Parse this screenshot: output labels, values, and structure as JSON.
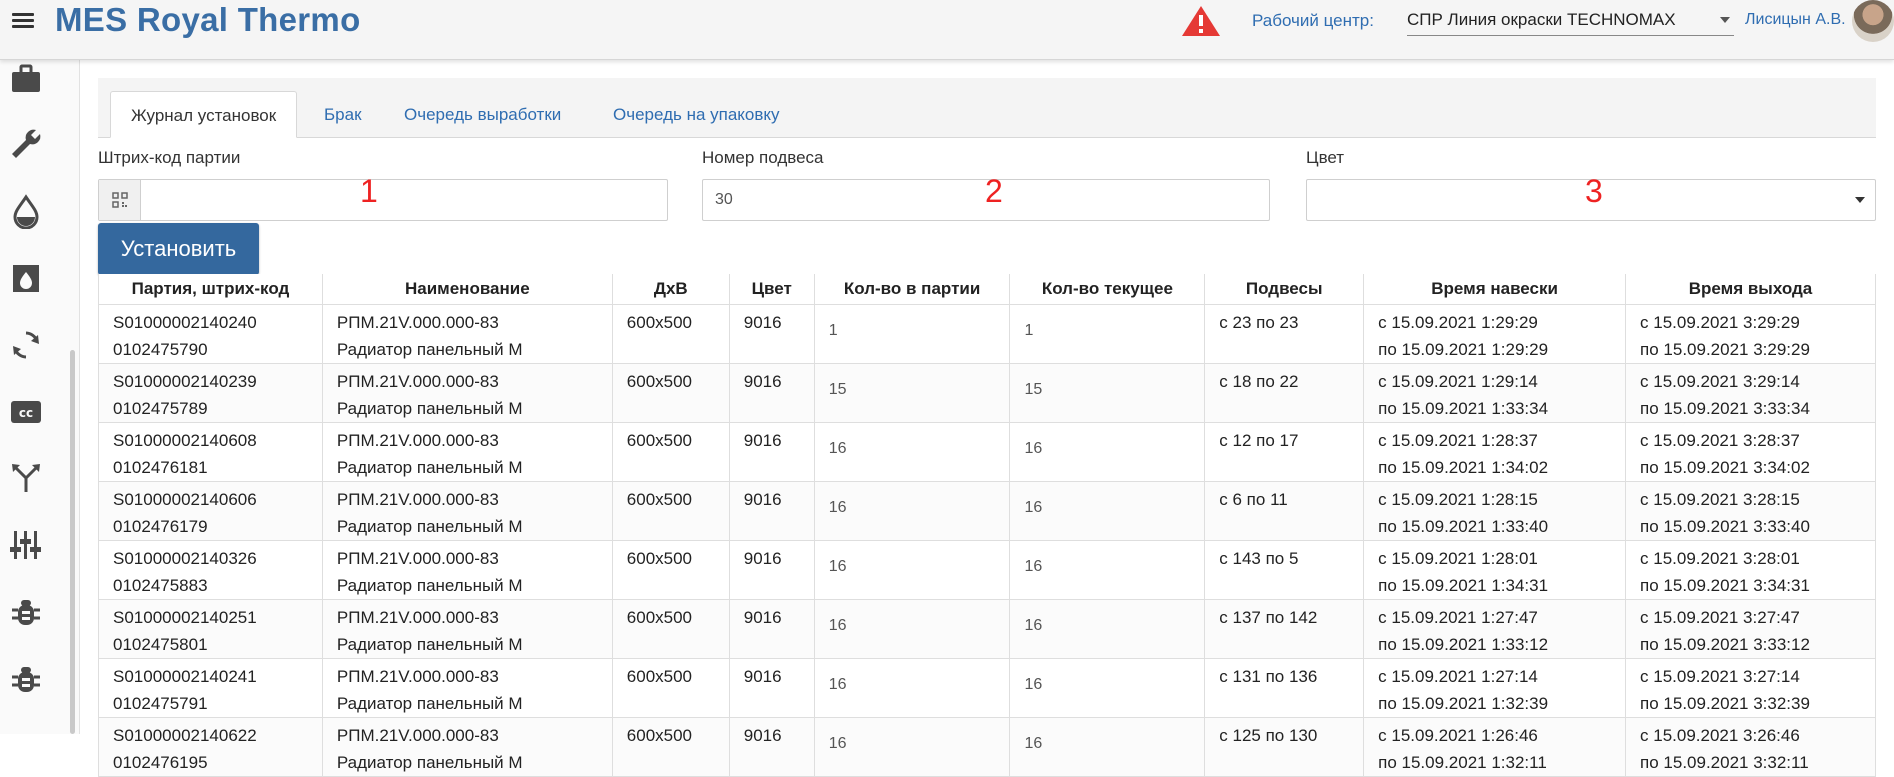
{
  "header": {
    "app_title": "MES Royal Thermo",
    "workcenter_label": "Рабочий центр:",
    "workcenter_value": "СПР Линия окраски TECHNOMAX",
    "user_name": "Лисицын А.В.",
    "colors": {
      "title": "#3a6ea5",
      "warning": "#e53935",
      "link": "#2f6db1"
    }
  },
  "sidebar": {
    "icons": [
      "briefcase-icon",
      "wrench-icon",
      "drop-icon",
      "furnace-icon",
      "refresh-icon",
      "cc-icon",
      "merge-icon",
      "equalizer-icon",
      "bug-icon",
      "bug-icon"
    ]
  },
  "tabs": [
    {
      "label": "Журнал установок",
      "active": true
    },
    {
      "label": "Брак",
      "active": false
    },
    {
      "label": "Очередь выработки",
      "active": false
    },
    {
      "label": "Очередь на упаковку",
      "active": false
    }
  ],
  "form": {
    "barcode_label": "Штрих-код партии",
    "barcode_value": "",
    "hanger_label": "Номер подвеса",
    "hanger_value": "30",
    "color_label": "Цвет",
    "color_value": "",
    "marker_1": "1",
    "marker_2": "2",
    "marker_3": "3",
    "install_button": "Установить"
  },
  "table": {
    "headers": [
      "Партия, штрих-код",
      "Наименование",
      "ДхВ",
      "Цвет",
      "Кол-во в партии",
      "Кол-во текущее",
      "Подвесы",
      "Время навески",
      "Время выхода"
    ],
    "rows": [
      {
        "batch": "S01000002140240",
        "barcode": "0102475790",
        "name1": "РПМ.21V.000.000-83",
        "name2": "Радиатор панельный М",
        "size": "600x500",
        "color": "9016",
        "qty_batch": "1",
        "qty_current": "1",
        "hangers": "с 23 по 23",
        "hang_from": "с 15.09.2021 1:29:29",
        "hang_to": "по 15.09.2021 1:29:29",
        "exit_from": "с 15.09.2021 3:29:29",
        "exit_to": "по 15.09.2021 3:29:29"
      },
      {
        "batch": "S01000002140239",
        "barcode": "0102475789",
        "name1": "РПМ.21V.000.000-83",
        "name2": "Радиатор панельный М",
        "size": "600x500",
        "color": "9016",
        "qty_batch": "15",
        "qty_current": "15",
        "hangers": "с 18 по 22",
        "hang_from": "с 15.09.2021 1:29:14",
        "hang_to": "по 15.09.2021 1:33:34",
        "exit_from": "с 15.09.2021 3:29:14",
        "exit_to": "по 15.09.2021 3:33:34"
      },
      {
        "batch": "S01000002140608",
        "barcode": "0102476181",
        "name1": "РПМ.21V.000.000-83",
        "name2": "Радиатор панельный М",
        "size": "600x500",
        "color": "9016",
        "qty_batch": "16",
        "qty_current": "16",
        "hangers": "с 12 по 17",
        "hang_from": "с 15.09.2021 1:28:37",
        "hang_to": "по 15.09.2021 1:34:02",
        "exit_from": "с 15.09.2021 3:28:37",
        "exit_to": "по 15.09.2021 3:34:02"
      },
      {
        "batch": "S01000002140606",
        "barcode": "0102476179",
        "name1": "РПМ.21V.000.000-83",
        "name2": "Радиатор панельный М",
        "size": "600x500",
        "color": "9016",
        "qty_batch": "16",
        "qty_current": "16",
        "hangers": "с 6 по 11",
        "hang_from": "с 15.09.2021 1:28:15",
        "hang_to": "по 15.09.2021 1:33:40",
        "exit_from": "с 15.09.2021 3:28:15",
        "exit_to": "по 15.09.2021 3:33:40"
      },
      {
        "batch": "S01000002140326",
        "barcode": "0102475883",
        "name1": "РПМ.21V.000.000-83",
        "name2": "Радиатор панельный М",
        "size": "600x500",
        "color": "9016",
        "qty_batch": "16",
        "qty_current": "16",
        "hangers": "с 143 по 5",
        "hang_from": "с 15.09.2021 1:28:01",
        "hang_to": "по 15.09.2021 1:34:31",
        "exit_from": "с 15.09.2021 3:28:01",
        "exit_to": "по 15.09.2021 3:34:31"
      },
      {
        "batch": "S01000002140251",
        "barcode": "0102475801",
        "name1": "РПМ.21V.000.000-83",
        "name2": "Радиатор панельный М",
        "size": "600x500",
        "color": "9016",
        "qty_batch": "16",
        "qty_current": "16",
        "hangers": "с 137 по 142",
        "hang_from": "с 15.09.2021 1:27:47",
        "hang_to": "по 15.09.2021 1:33:12",
        "exit_from": "с 15.09.2021 3:27:47",
        "exit_to": "по 15.09.2021 3:33:12"
      },
      {
        "batch": "S01000002140241",
        "barcode": "0102475791",
        "name1": "РПМ.21V.000.000-83",
        "name2": "Радиатор панельный М",
        "size": "600x500",
        "color": "9016",
        "qty_batch": "16",
        "qty_current": "16",
        "hangers": "с 131 по 136",
        "hang_from": "с 15.09.2021 1:27:14",
        "hang_to": "по 15.09.2021 1:32:39",
        "exit_from": "с 15.09.2021 3:27:14",
        "exit_to": "по 15.09.2021 3:32:39"
      },
      {
        "batch": "S01000002140622",
        "barcode": "0102476195",
        "name1": "РПМ.21V.000.000-83",
        "name2": "Радиатор панельный М",
        "size": "600x500",
        "color": "9016",
        "qty_batch": "16",
        "qty_current": "16",
        "hangers": "с 125 по 130",
        "hang_from": "с 15.09.2021 1:26:46",
        "hang_to": "по 15.09.2021 1:32:11",
        "exit_from": "с 15.09.2021 3:26:46",
        "exit_to": "по 15.09.2021 3:32:11"
      }
    ]
  }
}
